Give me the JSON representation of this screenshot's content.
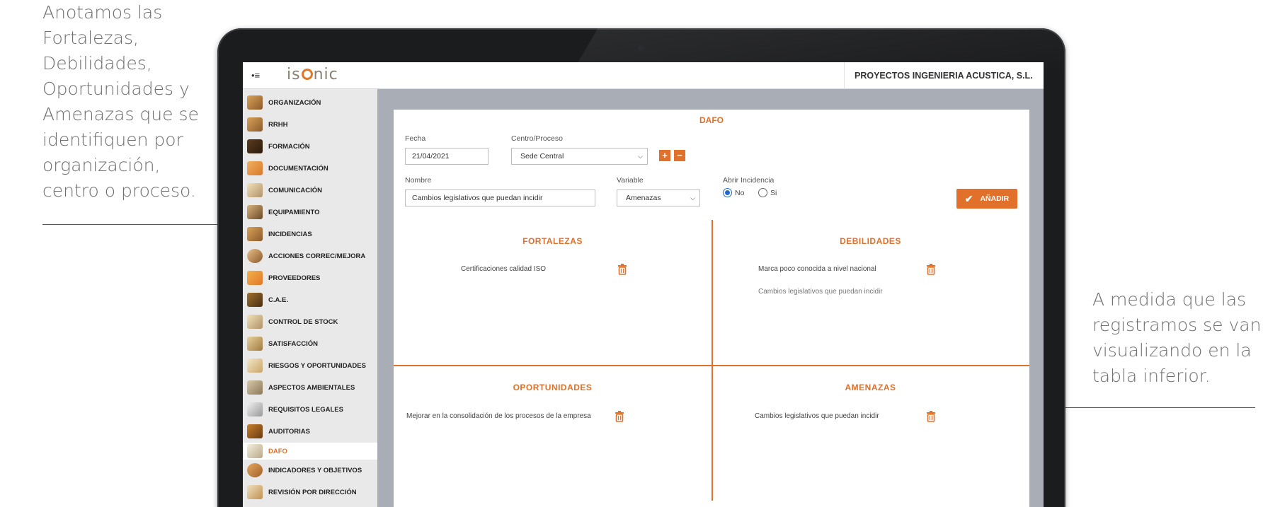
{
  "annotations": {
    "left": "Anotamos las Fortalezas, Debilidades, Oportunidades y Amenazas que se identifiquen por organización, centro o proceso.",
    "right": "A medida que las registramos se van visualizando en la tabla inferior."
  },
  "app": {
    "logo": "isonic",
    "company": "PROYECTOS INGENIERIA ACUSTICA, S.L."
  },
  "sidebar": {
    "items": [
      {
        "label": "ORGANIZACIÓN"
      },
      {
        "label": "RRHH"
      },
      {
        "label": "FORMACIÓN"
      },
      {
        "label": "DOCUMENTACIÓN"
      },
      {
        "label": "COMUNICACIÓN"
      },
      {
        "label": "EQUIPAMIENTO"
      },
      {
        "label": "INCIDENCIAS"
      },
      {
        "label": "ACCIONES CORREC/MEJORA"
      },
      {
        "label": "PROVEEDORES"
      },
      {
        "label": "C.A.E."
      },
      {
        "label": "CONTROL DE STOCK"
      },
      {
        "label": "SATISFACCIÓN"
      },
      {
        "label": "RIESGOS Y OPORTUNIDADES"
      },
      {
        "label": "ASPECTOS AMBIENTALES"
      },
      {
        "label": "REQUISITOS LEGALES"
      },
      {
        "label": "AUDITORIAS"
      },
      {
        "label": "DAFO",
        "active": true
      },
      {
        "label": "INDICADORES Y OBJETIVOS"
      },
      {
        "label": "REVISIÓN POR DIRECCIÓN"
      }
    ]
  },
  "form": {
    "title": "DAFO",
    "fecha_label": "Fecha",
    "fecha_value": "21/04/2021",
    "centro_label": "Centro/Proceso",
    "centro_value": "Sede Central",
    "nombre_label": "Nombre",
    "nombre_value": "Cambios legislativos que puedan incidir",
    "variable_label": "Variable",
    "variable_value": "Amenazas",
    "incidencia_label": "Abrir Incidencia",
    "radio_no": "No",
    "radio_si": "Si",
    "add_label": "AÑADIR",
    "plus": "+",
    "minus": "−"
  },
  "quadrants": {
    "fortalezas": {
      "title": "FORTALEZAS",
      "items": [
        "Certificaciones calidad ISO"
      ]
    },
    "debilidades": {
      "title": "DEBILIDADES",
      "items": [
        "Marca poco conocida a nivel nacional",
        "Cambios legislativos que puedan incidir"
      ]
    },
    "oportunidades": {
      "title": "OPORTUNIDADES",
      "items": [
        "Mejorar en la consolidación de los procesos de la empresa"
      ]
    },
    "amenazas": {
      "title": "AMENAZAS",
      "items": [
        "Cambios legislativos que puedan incidir"
      ]
    }
  },
  "colors": {
    "accent": "#e0702a",
    "sidebar_bg": "#e9e9e9",
    "screen_bg": "#a8adb6"
  }
}
